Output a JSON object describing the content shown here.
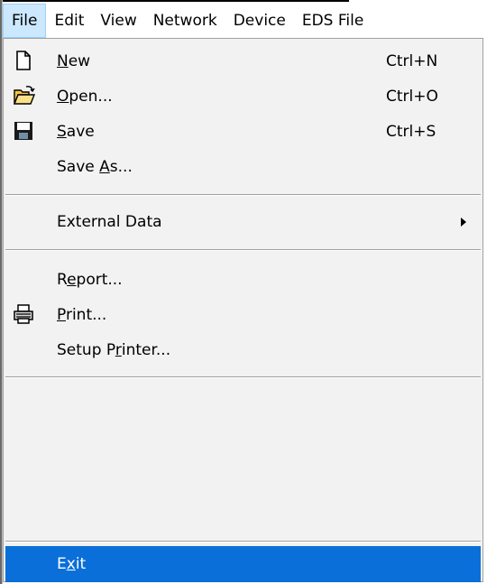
{
  "menubar": {
    "items": [
      {
        "label": "File",
        "active": true
      },
      {
        "label": "Edit"
      },
      {
        "label": "View"
      },
      {
        "label": "Network"
      },
      {
        "label": "Device"
      },
      {
        "label": "EDS File"
      }
    ]
  },
  "file_menu": {
    "new": {
      "label_mn": "N",
      "label_rest": "ew",
      "shortcut": "Ctrl+N"
    },
    "open": {
      "label_mn": "O",
      "label_rest": "pen...",
      "shortcut": "Ctrl+O"
    },
    "save": {
      "label_mn": "S",
      "label_rest": "ave",
      "shortcut": "Ctrl+S"
    },
    "save_as": {
      "label_pre": "Save ",
      "label_mn": "A",
      "label_rest": "s..."
    },
    "external_data": {
      "label": "External Data"
    },
    "report": {
      "label_pre": "R",
      "label_mn": "e",
      "label_rest": "port..."
    },
    "print": {
      "label_mn": "P",
      "label_rest": "rint..."
    },
    "setup_printer": {
      "label_pre": "Setup P",
      "label_mn": "r",
      "label_rest": "inter..."
    },
    "exit": {
      "label_pre": "E",
      "label_mn": "x",
      "label_rest": "it",
      "highlighted": true
    }
  },
  "colors": {
    "highlight": "#0a6fd8",
    "menu_bg": "#f2f2f2",
    "active_menu_bg": "#cce8ff"
  }
}
